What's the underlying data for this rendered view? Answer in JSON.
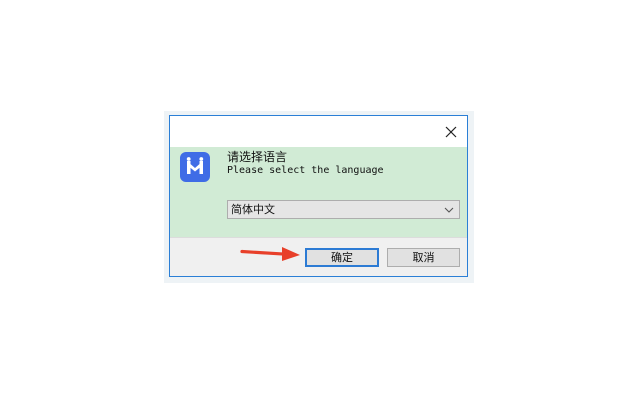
{
  "dialog": {
    "prompt_cn": "请选择语言",
    "prompt_en": "Please select the language",
    "language_select": {
      "selected": "简体中文"
    },
    "buttons": {
      "ok_label": "确定",
      "cancel_label": "取消"
    }
  },
  "icons": {
    "close": "close-icon",
    "app": "app-logo-icon",
    "dropdown": "chevron-down-icon",
    "annotation": "red-arrow-icon"
  },
  "colors": {
    "window_border": "#2b7fd6",
    "content_background": "#d1ebd5",
    "footer_background": "#f0f0f0",
    "app_icon": "#3f6ce6",
    "default_button_border": "#2c7bd4",
    "annotation_arrow": "#e8402a"
  }
}
